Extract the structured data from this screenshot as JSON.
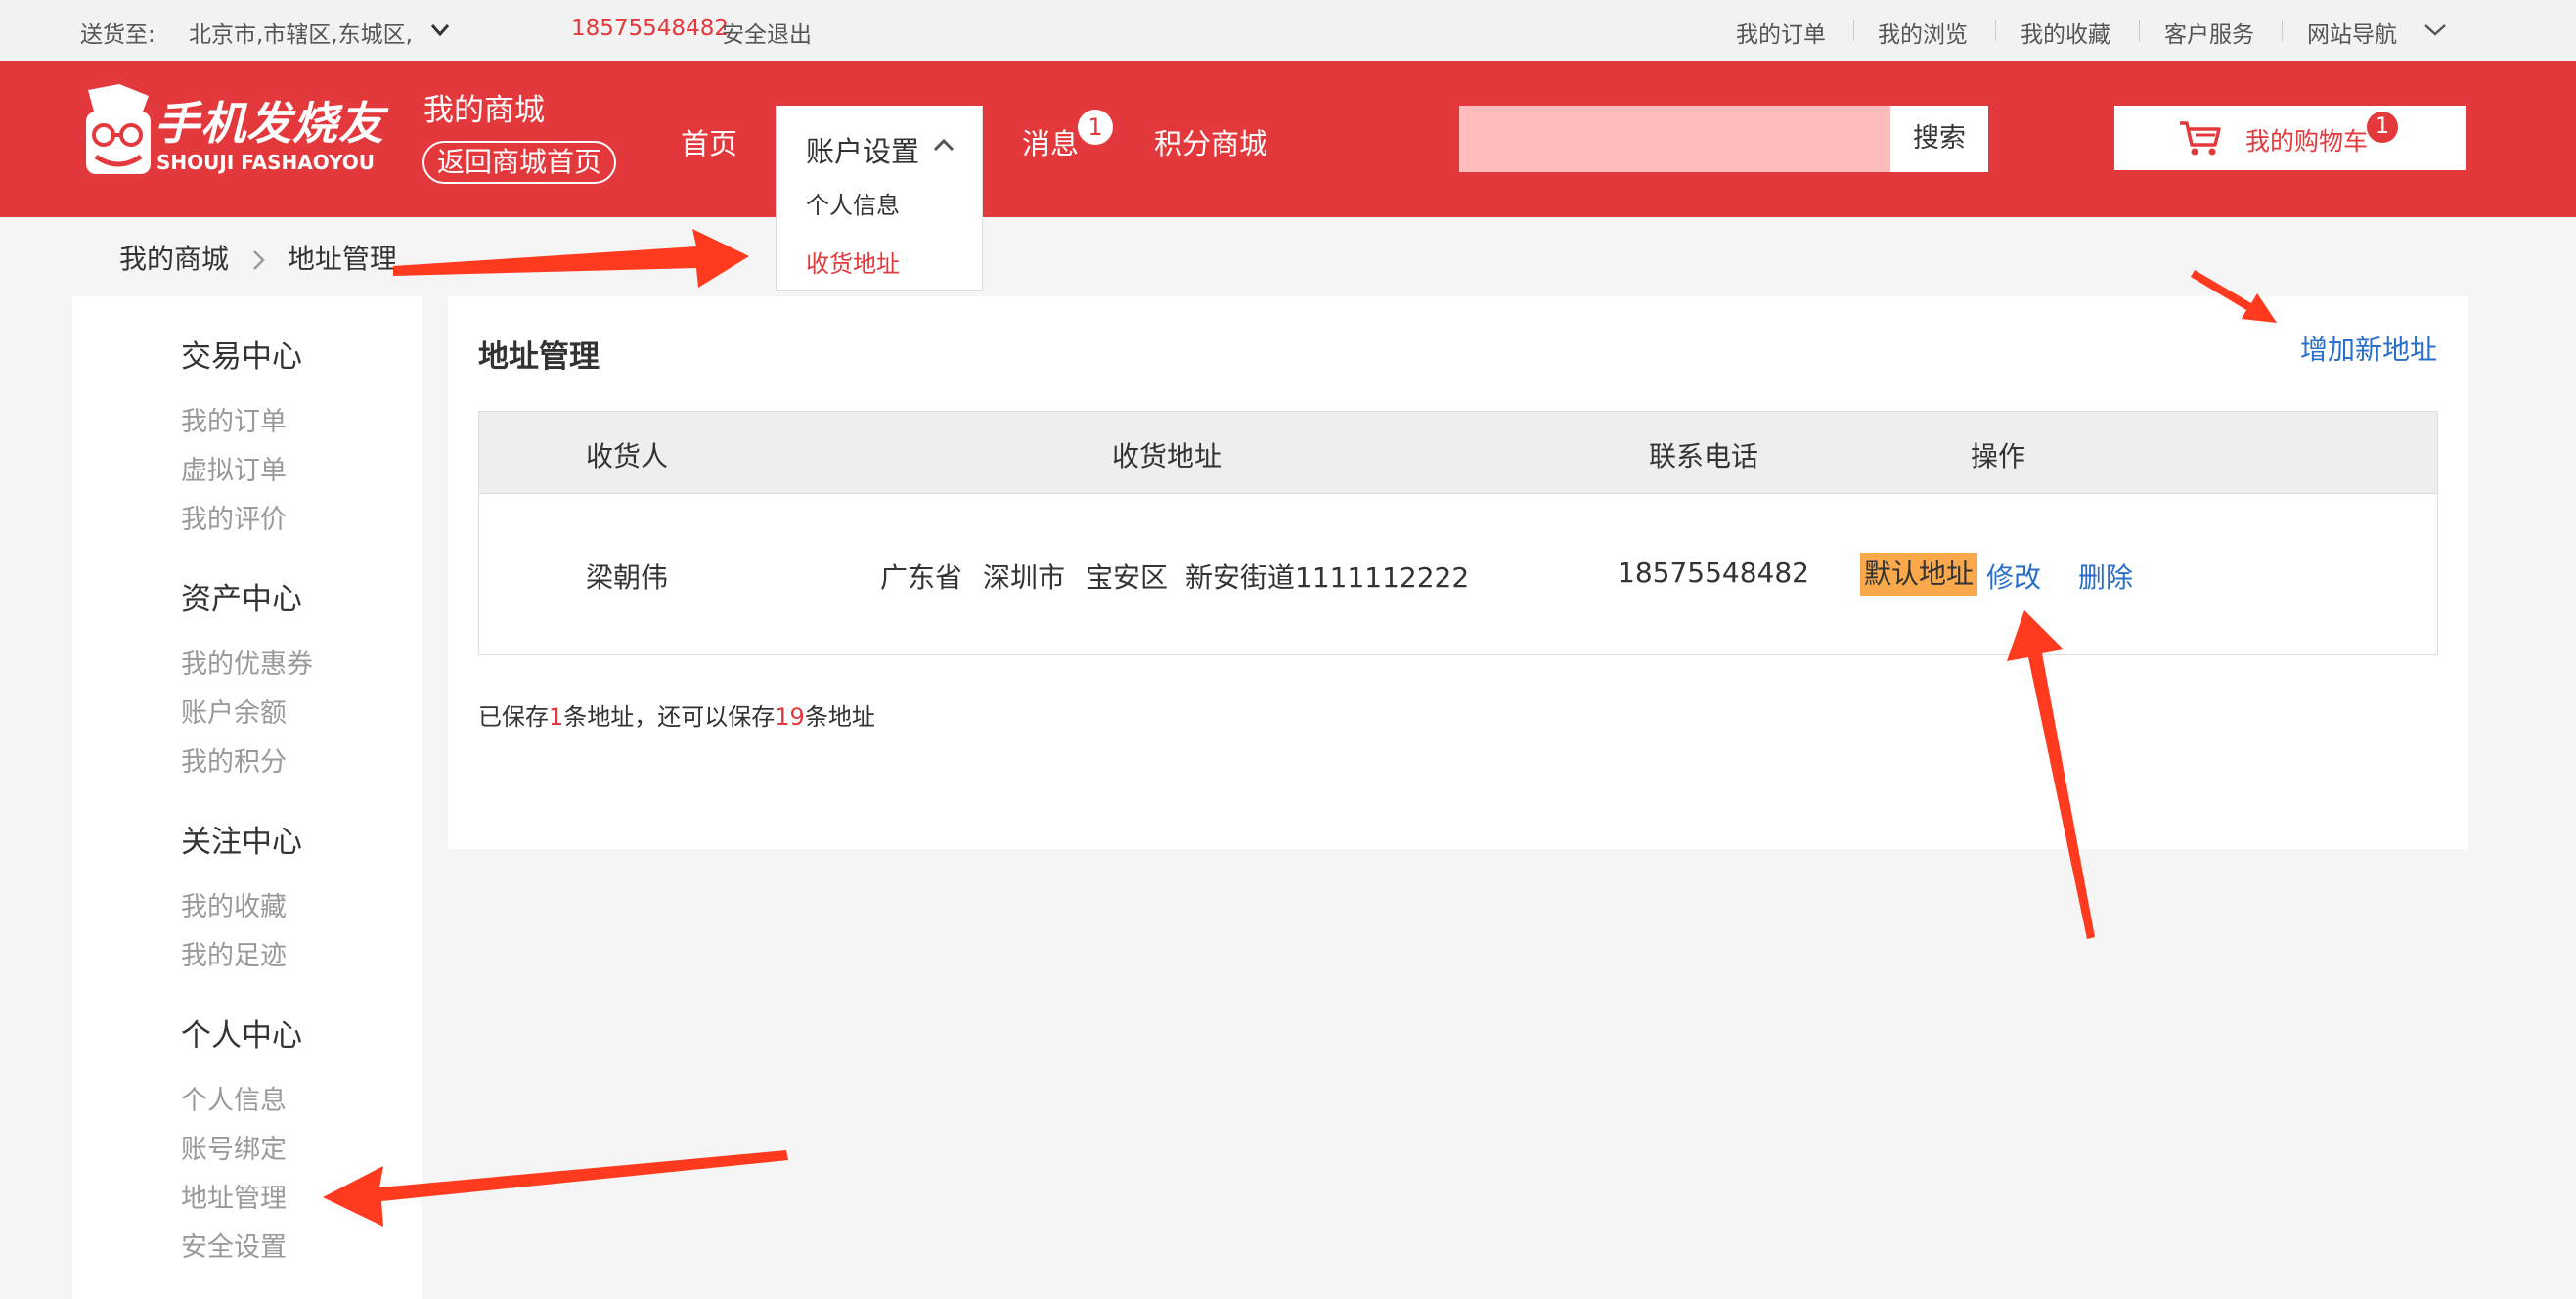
{
  "topbar": {
    "ship_label": "送货至:",
    "ship_location": "北京市,市辖区,东城区,",
    "phone": "18575548482",
    "logout": "安全退出",
    "links": [
      "我的订单",
      "我的浏览",
      "我的收藏",
      "客户服务",
      "网站导航"
    ]
  },
  "header": {
    "logo_cn": "手机发烧友",
    "logo_en": "SHOUJI FASHAOYOU",
    "mall_title": "我的商城",
    "back_home": "返回商城首页",
    "nav": {
      "home": "首页",
      "account_settings": "账户设置",
      "messages": "消息",
      "messages_badge": "1",
      "points_mall": "积分商城"
    },
    "dropdown": [
      "个人信息",
      "收货地址"
    ],
    "search_placeholder": "",
    "search_button": "搜索",
    "cart_label": "我的购物车",
    "cart_badge": "1"
  },
  "breadcrumb": [
    "我的商城",
    "地址管理"
  ],
  "sidebar": [
    {
      "title": "交易中心",
      "items": [
        "我的订单",
        "虚拟订单",
        "我的评价"
      ]
    },
    {
      "title": "资产中心",
      "items": [
        "我的优惠券",
        "账户余额",
        "我的积分"
      ]
    },
    {
      "title": "关注中心",
      "items": [
        "我的收藏",
        "我的足迹"
      ]
    },
    {
      "title": "个人中心",
      "items": [
        "个人信息",
        "账号绑定",
        "地址管理",
        "安全设置"
      ]
    }
  ],
  "main": {
    "title": "地址管理",
    "add_address": "增加新地址",
    "columns": [
      "收货人",
      "收货地址",
      "联系电话",
      "操作"
    ],
    "row": {
      "name": "梁朝伟",
      "province": "广东省",
      "city": "深圳市",
      "district": "宝安区",
      "street": "新安街道1111112222",
      "phone": "18575548482",
      "default_tag": "默认地址",
      "edit": "修改",
      "delete": "删除"
    },
    "summary": {
      "prefix": "已保存",
      "saved": "1",
      "middle": "条地址，还可以保存",
      "remaining": "19",
      "suffix": "条地址"
    }
  },
  "colors": {
    "brand_red": "#e4393c",
    "link_blue": "#2a6fc9",
    "default_tag_bg": "#f9a84b",
    "annotation_arrow": "#ff3a1f"
  }
}
